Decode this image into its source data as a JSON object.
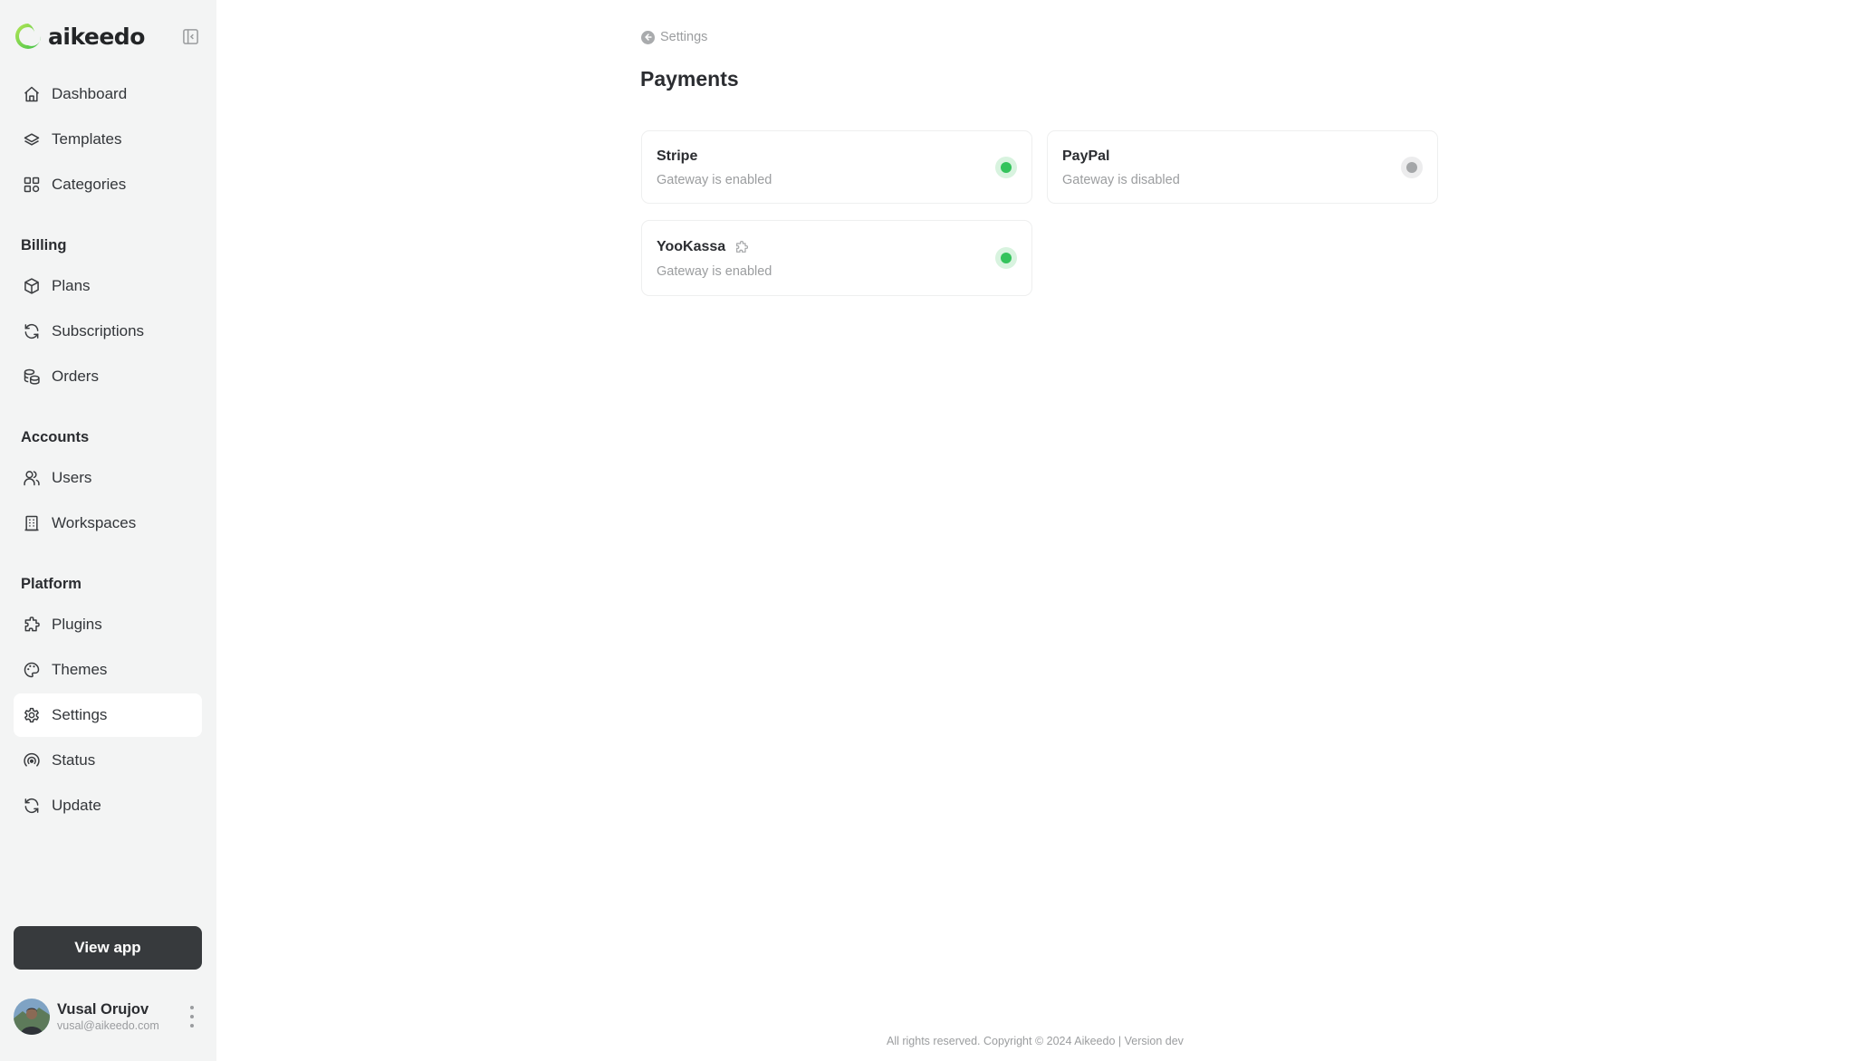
{
  "brand": {
    "name": "aikeedo",
    "logo_colors": [
      "#a6e04f",
      "#4cc94a"
    ]
  },
  "sidebar": {
    "collapse_icon": "sidebar-collapse-icon",
    "top_items": [
      {
        "label": "Dashboard",
        "icon": "home-icon"
      },
      {
        "label": "Templates",
        "icon": "layers-icon"
      },
      {
        "label": "Categories",
        "icon": "grid-icon"
      }
    ],
    "sections": [
      {
        "title": "Billing",
        "items": [
          {
            "label": "Plans",
            "icon": "box-icon"
          },
          {
            "label": "Subscriptions",
            "icon": "refresh-icon"
          },
          {
            "label": "Orders",
            "icon": "coins-icon"
          }
        ]
      },
      {
        "title": "Accounts",
        "items": [
          {
            "label": "Users",
            "icon": "users-icon"
          },
          {
            "label": "Workspaces",
            "icon": "building-icon"
          }
        ]
      },
      {
        "title": "Platform",
        "items": [
          {
            "label": "Plugins",
            "icon": "puzzle-icon"
          },
          {
            "label": "Themes",
            "icon": "palette-icon"
          },
          {
            "label": "Settings",
            "icon": "gear-icon",
            "active": true
          },
          {
            "label": "Status",
            "icon": "broadcast-icon"
          },
          {
            "label": "Update",
            "icon": "refresh-icon"
          }
        ]
      }
    ],
    "view_app_label": "View app",
    "user": {
      "name": "Vusal Orujov",
      "email": "vusal@aikeedo.com"
    }
  },
  "main": {
    "breadcrumb": "Settings",
    "title": "Payments",
    "gateways": [
      {
        "name": "Stripe",
        "status": "Gateway is enabled",
        "enabled": true,
        "plugin": false
      },
      {
        "name": "PayPal",
        "status": "Gateway is disabled",
        "enabled": false,
        "plugin": false
      },
      {
        "name": "YooKassa",
        "status": "Gateway is enabled",
        "enabled": true,
        "plugin": true
      }
    ],
    "status_colors": {
      "enabled": "#34c35c",
      "enabled_ring": "#d8f3df",
      "disabled": "#a4a6a8",
      "disabled_ring": "#ececed"
    }
  },
  "footer": {
    "text": "All rights reserved. Copyright © 2024 Aikeedo | Version dev"
  }
}
